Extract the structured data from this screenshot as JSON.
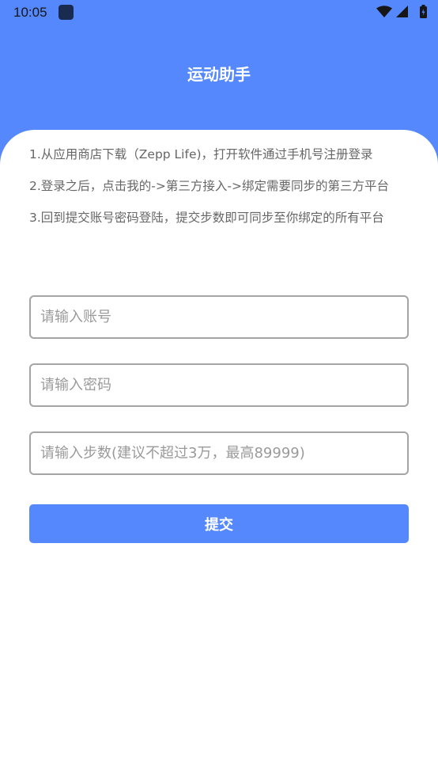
{
  "status_bar": {
    "time": "10:05"
  },
  "header": {
    "title": "运动助手"
  },
  "instructions": [
    "1.从应用商店下载（Zepp Life)，打开软件通过手机号注册登录",
    "2.登录之后，点击我的->第三方接入->绑定需要同步的第三方平台",
    "3.回到提交账号密码登陆，提交步数即可同步至你绑定的所有平台"
  ],
  "form": {
    "account_placeholder": "请输入账号",
    "password_placeholder": "请输入密码",
    "steps_placeholder": "请输入步数(建议不超过3万，最高89999)",
    "submit_label": "提交"
  },
  "colors": {
    "primary": "#5588fc",
    "text_muted": "#666666",
    "field_border": "#a5a5a5"
  }
}
